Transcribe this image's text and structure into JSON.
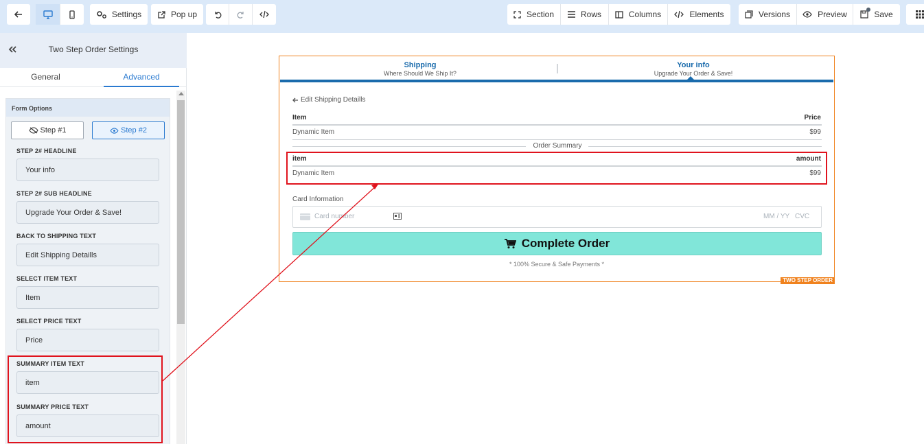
{
  "toolbar": {
    "settings": "Settings",
    "popup": "Pop up",
    "section": "Section",
    "rows": "Rows",
    "columns": "Columns",
    "elements": "Elements",
    "versions": "Versions",
    "preview": "Preview",
    "save": "Save"
  },
  "sidebar": {
    "title": "Two Step Order Settings",
    "tabs": [
      "General",
      "Advanced"
    ],
    "active_tab": "Advanced",
    "panel_title": "Form Options",
    "step1": "Step #1",
    "step2": "Step #2",
    "fields": [
      {
        "label": "STEP 2# HEADLINE",
        "value": "Your info"
      },
      {
        "label": "STEP 2# SUB HEADLINE",
        "value": "Upgrade Your Order & Save!"
      },
      {
        "label": "BACK TO SHIPPING TEXT",
        "value": "Edit Shipping Detaills"
      },
      {
        "label": "SELECT ITEM TEXT",
        "value": "Item"
      },
      {
        "label": "SELECT PRICE TEXT",
        "value": "Price"
      },
      {
        "label": "SUMMARY ITEM TEXT",
        "value": "item"
      },
      {
        "label": "SUMMARY PRICE TEXT",
        "value": "amount"
      }
    ]
  },
  "form": {
    "step1_title": "Shipping",
    "step1_sub": "Where Should We Ship It?",
    "step2_title": "Your info",
    "step2_sub": "Upgrade Your Order & Save!",
    "back_link": "Edit Shipping Detaills",
    "item_header": "Item",
    "price_header": "Price",
    "item_name": "Dynamic Item",
    "item_price": "$99",
    "order_summary": "Order Summary",
    "summary_item_header": "item",
    "summary_price_header": "amount",
    "summary_item_name": "Dynamic Item",
    "summary_item_price": "$99",
    "card_label": "Card Information",
    "card_placeholder": "Card number",
    "card_expiry": "MM / YY",
    "card_cvc": "CVC",
    "complete_button": "Complete Order",
    "secure_note": "* 100% Secure & Safe Payments *",
    "badge": "TWO STEP ORDER"
  },
  "colors": {
    "accent": "#2a7ad0",
    "step_bar": "#1a6bac",
    "form_border": "#f0821e",
    "button": "#81e6d9",
    "annotation": "#e0131d"
  }
}
